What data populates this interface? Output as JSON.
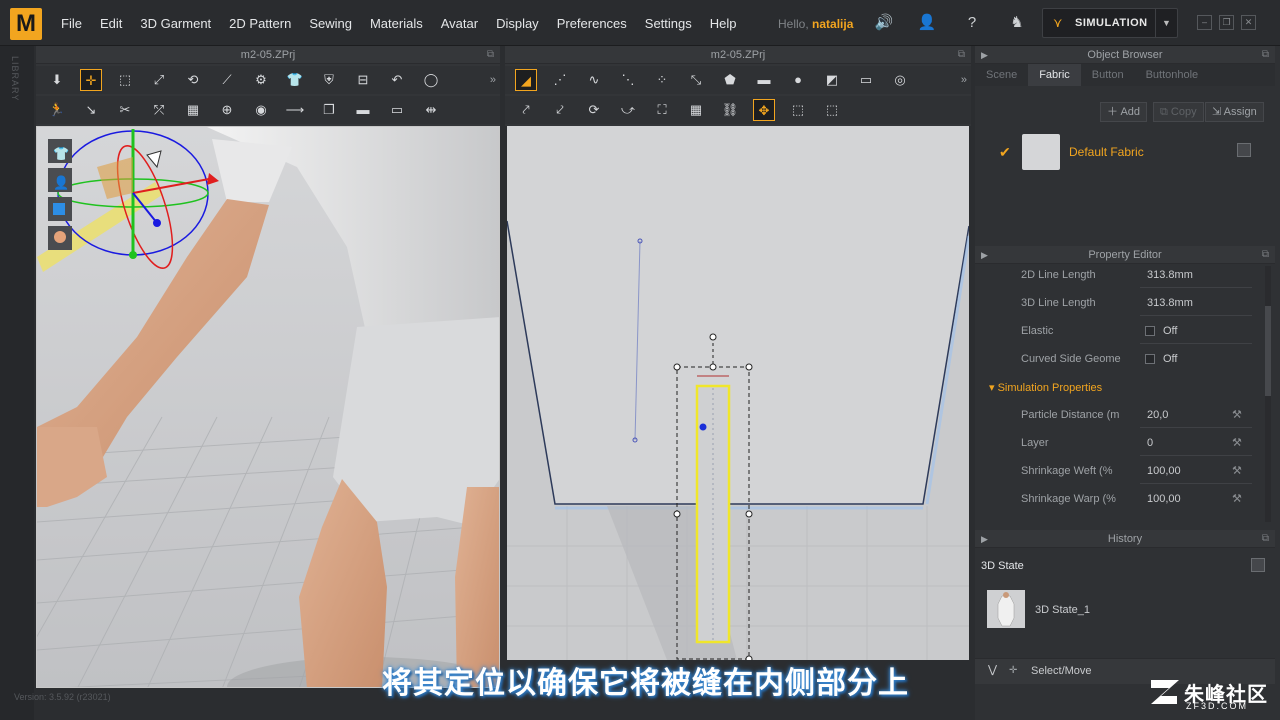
{
  "app": {
    "logo": "M",
    "menu": [
      "File",
      "Edit",
      "3D Garment",
      "2D Pattern",
      "Sewing",
      "Materials",
      "Avatar",
      "Display",
      "Preferences",
      "Settings",
      "Help"
    ],
    "hello_prefix": "Hello,",
    "username": "natalija",
    "simulation_label": "SIMULATION",
    "accent": "#f2a51f",
    "library_label": "LIBRARY",
    "version_label": "Version: 3.5.92",
    "build_label": "(r23021)"
  },
  "viewport3d": {
    "title": "m2-05.ZPrj"
  },
  "viewport2d": {
    "title": "m2-05.ZPrj"
  },
  "object_browser": {
    "title": "Object Browser",
    "tabs": [
      "Scene",
      "Fabric",
      "Button",
      "Buttonhole"
    ],
    "active_tab": "Fabric",
    "add_label": "Add",
    "copy_label": "Copy",
    "assign_label": "Assign",
    "fabric_name": "Default Fabric"
  },
  "property_editor": {
    "title": "Property Editor",
    "rows": [
      {
        "label": "2D Line Length",
        "value": "313.8mm"
      },
      {
        "label": "3D Line Length",
        "value": "313.8mm"
      },
      {
        "label": "Elastic",
        "value": "Off"
      },
      {
        "label": "Curved Side Geome",
        "value": "Off"
      }
    ],
    "section_label": "Simulation Properties",
    "sim_rows": [
      {
        "label": "Particle Distance (m",
        "value": "20,0"
      },
      {
        "label": "Layer",
        "value": "0"
      },
      {
        "label": "Shrinkage Weft (%",
        "value": "100,00"
      },
      {
        "label": "Shrinkage Warp (%",
        "value": "100,00"
      }
    ]
  },
  "history": {
    "title": "History",
    "state_header": "3D State",
    "state_item": "3D State_1",
    "action": "Select/Move"
  },
  "subtitle": "将其定位以确保它将被缝在内侧部分上",
  "watermark": {
    "cn": "朱峰社区",
    "en": "ZF3D.COM"
  }
}
